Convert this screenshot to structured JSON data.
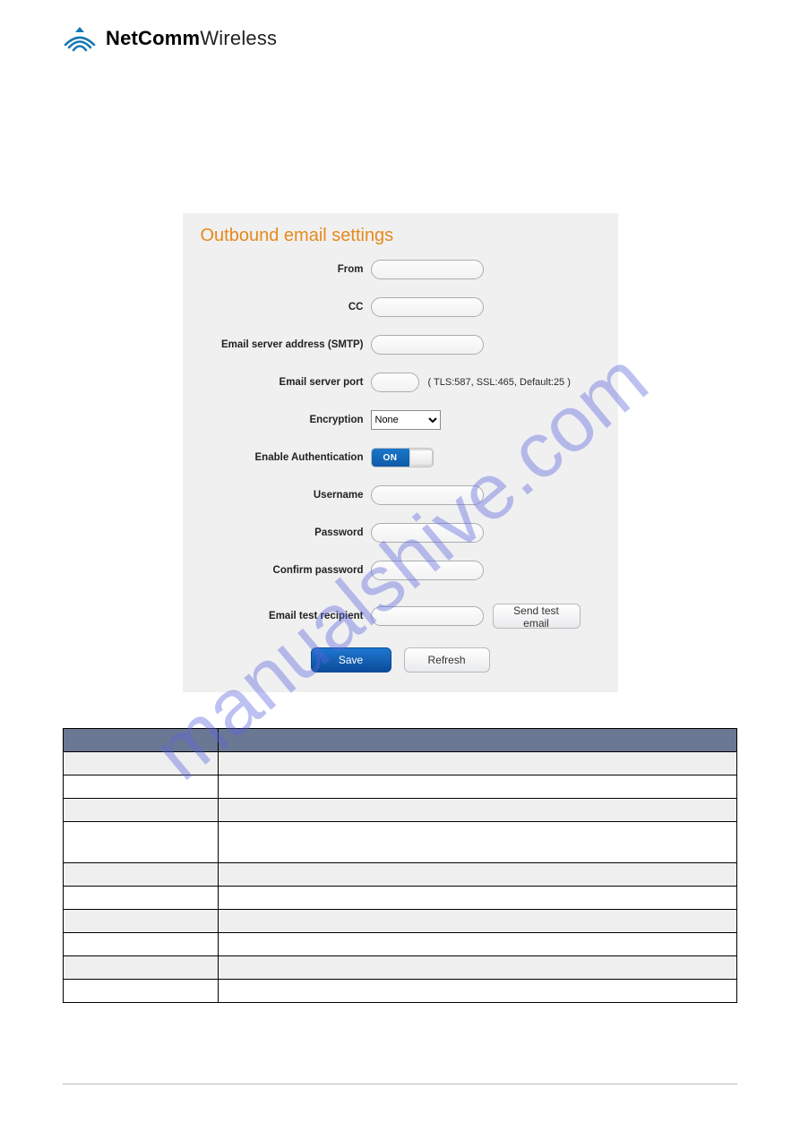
{
  "logo": {
    "bold": "NetComm",
    "light": "Wireless"
  },
  "watermark": "manualshive.com",
  "screenshot": {
    "title": "Outbound email settings",
    "labels": {
      "from": "From",
      "cc": "CC",
      "server_addr": "Email server address (SMTP)",
      "server_port": "Email server port",
      "port_hint": "( TLS:587, SSL:465, Default:25 )",
      "encryption": "Encryption",
      "encryption_value": "None",
      "enable_auth": "Enable Authentication",
      "toggle_on": "ON",
      "username": "Username",
      "password": "Password",
      "confirm_pw": "Confirm password",
      "test_recipient": "Email test recipient"
    },
    "buttons": {
      "send_test": "Send test email",
      "save": "Save",
      "refresh": "Refresh"
    }
  },
  "table": {
    "header": [
      "",
      ""
    ],
    "rows": [
      {
        "shade": true,
        "cells": [
          "",
          ""
        ]
      },
      {
        "shade": false,
        "cells": [
          "",
          ""
        ]
      },
      {
        "shade": true,
        "cells": [
          "",
          ""
        ]
      },
      {
        "shade": false,
        "cells": [
          "",
          ""
        ],
        "tall": true
      },
      {
        "shade": true,
        "cells": [
          "",
          ""
        ]
      },
      {
        "shade": false,
        "cells": [
          "",
          ""
        ]
      },
      {
        "shade": true,
        "cells": [
          "",
          ""
        ]
      },
      {
        "shade": false,
        "cells": [
          "",
          ""
        ]
      },
      {
        "shade": true,
        "cells": [
          "",
          ""
        ]
      },
      {
        "shade": false,
        "cells": [
          "",
          ""
        ]
      }
    ]
  }
}
